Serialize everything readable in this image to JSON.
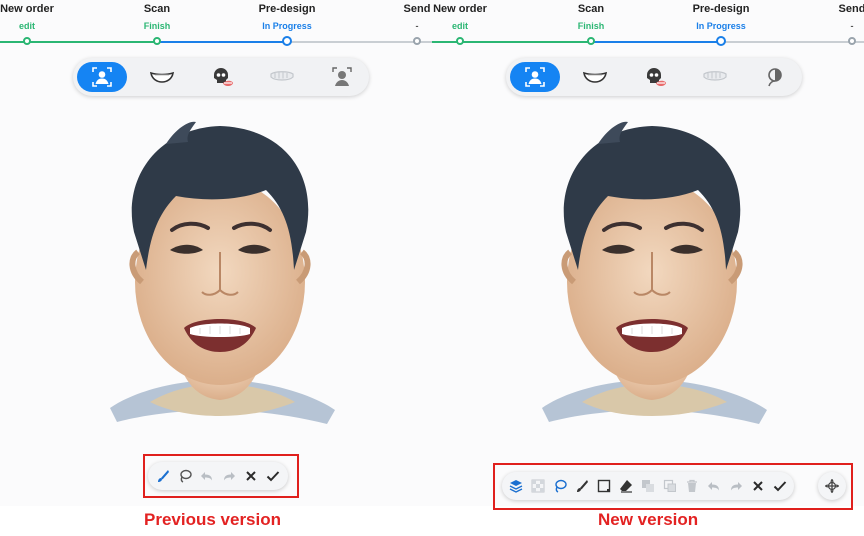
{
  "steps": [
    {
      "title": "New order",
      "status": "edit",
      "state": "done"
    },
    {
      "title": "Scan",
      "status": "Finish",
      "state": "done"
    },
    {
      "title": "Pre-design",
      "status": "In Progress",
      "state": "current"
    },
    {
      "title": "Send",
      "status": "-",
      "state": "pending"
    }
  ],
  "colors": {
    "done": "#2bb673",
    "current": "#1a7fe8",
    "pending": "#9aa4ad",
    "highlight": "#e0201d",
    "accent": "#1584f3"
  },
  "mode_icons": [
    "face-scan-icon",
    "smile-icon",
    "skull-teeth-icon",
    "dental-arch-icon",
    "head-profile-icon"
  ],
  "previous_toolbar": [
    "brush-icon",
    "lasso-icon",
    "undo-icon",
    "redo-icon",
    "close-icon",
    "check-icon"
  ],
  "new_toolbar": [
    "layers-icon",
    "transparency-icon",
    "lasso-icon",
    "brush-icon",
    "rectangle-select-icon",
    "eraser-icon",
    "copy-icon",
    "paste-icon",
    "delete-icon",
    "undo-icon",
    "redo-icon",
    "close-icon",
    "check-icon",
    "move-icon"
  ],
  "captions": {
    "previous": "Previous version",
    "new": "New version"
  }
}
